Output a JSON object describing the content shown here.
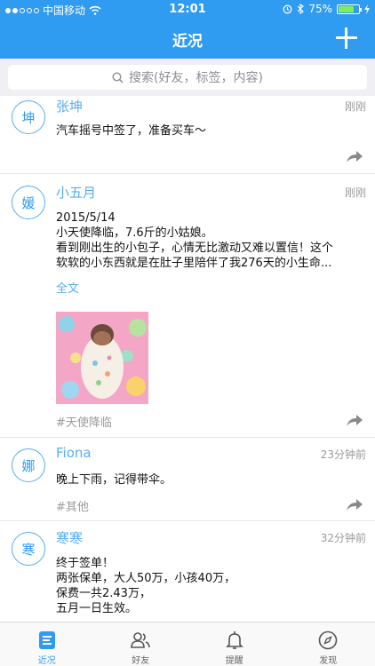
{
  "status_bar": {
    "carrier": "中国移动",
    "time": "12:01",
    "battery_percent_label": "75%",
    "battery_level": 0.75,
    "signal_bars": 2
  },
  "header": {
    "title": "近况"
  },
  "search": {
    "placeholder": "搜索(好友，标签，内容)"
  },
  "posts": [
    {
      "avatar": "坤",
      "name": "张坤",
      "time": "刚刚",
      "lines": [
        "汽车摇号中签了，准备买车～"
      ],
      "tag": ""
    },
    {
      "avatar": "媛",
      "name": "小五月",
      "time": "刚刚",
      "lines": [
        "2015/5/14",
        "小天使降临，7.6斤的小姑娘。",
        "看到刚出生的小包子，心情无比激动又难以置信！这个",
        "软软的小东西就是在肚子里陪伴了我276天的小生命..."
      ],
      "full_text_label": "全文",
      "tag": "#天使降临"
    },
    {
      "avatar": "娜",
      "name": "Fiona",
      "time": "23分钟前",
      "lines": [
        "晚上下雨，记得带伞。"
      ],
      "tag": "#其他"
    },
    {
      "avatar": "寒",
      "name": "寒寒",
      "time": "32分钟前",
      "lines": [
        "终于签单！",
        "两张保单，大人50万，小孩40万，",
        "保费一共2.43万，",
        "五月一日生效。"
      ],
      "tag": ""
    }
  ],
  "tabs": [
    {
      "label": "近况",
      "icon": "list-icon",
      "active": true
    },
    {
      "label": "好友",
      "icon": "friends-icon",
      "active": false
    },
    {
      "label": "提醒",
      "icon": "bell-icon",
      "active": false
    },
    {
      "label": "发现",
      "icon": "compass-icon",
      "active": false
    }
  ],
  "colors": {
    "brand": "#2f9bf1",
    "name_text": "#56aef2",
    "meta_text": "#9b9b9b"
  }
}
